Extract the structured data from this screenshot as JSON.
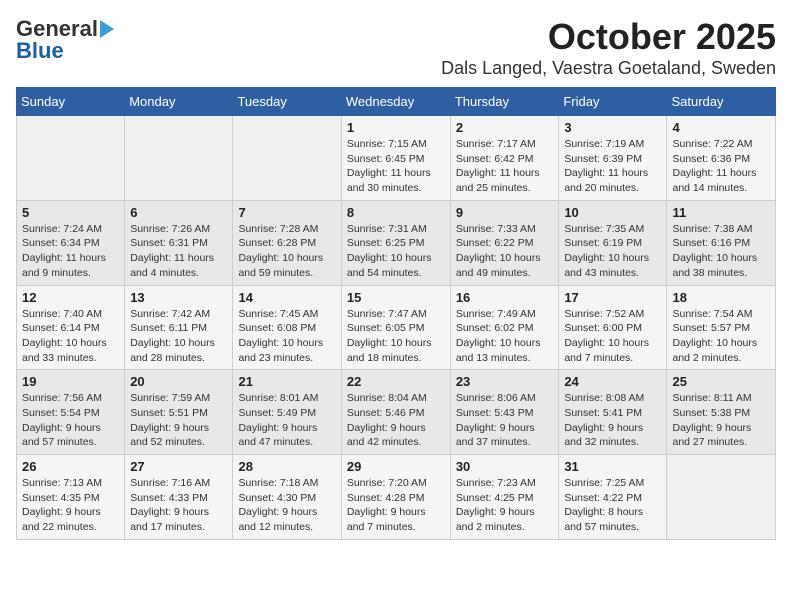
{
  "logo": {
    "text_general": "General",
    "text_blue": "Blue"
  },
  "title": "October 2025",
  "subtitle": "Dals Langed, Vaestra Goetaland, Sweden",
  "days_header": [
    "Sunday",
    "Monday",
    "Tuesday",
    "Wednesday",
    "Thursday",
    "Friday",
    "Saturday"
  ],
  "weeks": [
    [
      {
        "day": "",
        "detail": ""
      },
      {
        "day": "",
        "detail": ""
      },
      {
        "day": "",
        "detail": ""
      },
      {
        "day": "1",
        "detail": "Sunrise: 7:15 AM\nSunset: 6:45 PM\nDaylight: 11 hours\nand 30 minutes."
      },
      {
        "day": "2",
        "detail": "Sunrise: 7:17 AM\nSunset: 6:42 PM\nDaylight: 11 hours\nand 25 minutes."
      },
      {
        "day": "3",
        "detail": "Sunrise: 7:19 AM\nSunset: 6:39 PM\nDaylight: 11 hours\nand 20 minutes."
      },
      {
        "day": "4",
        "detail": "Sunrise: 7:22 AM\nSunset: 6:36 PM\nDaylight: 11 hours\nand 14 minutes."
      }
    ],
    [
      {
        "day": "5",
        "detail": "Sunrise: 7:24 AM\nSunset: 6:34 PM\nDaylight: 11 hours\nand 9 minutes."
      },
      {
        "day": "6",
        "detail": "Sunrise: 7:26 AM\nSunset: 6:31 PM\nDaylight: 11 hours\nand 4 minutes."
      },
      {
        "day": "7",
        "detail": "Sunrise: 7:28 AM\nSunset: 6:28 PM\nDaylight: 10 hours\nand 59 minutes."
      },
      {
        "day": "8",
        "detail": "Sunrise: 7:31 AM\nSunset: 6:25 PM\nDaylight: 10 hours\nand 54 minutes."
      },
      {
        "day": "9",
        "detail": "Sunrise: 7:33 AM\nSunset: 6:22 PM\nDaylight: 10 hours\nand 49 minutes."
      },
      {
        "day": "10",
        "detail": "Sunrise: 7:35 AM\nSunset: 6:19 PM\nDaylight: 10 hours\nand 43 minutes."
      },
      {
        "day": "11",
        "detail": "Sunrise: 7:38 AM\nSunset: 6:16 PM\nDaylight: 10 hours\nand 38 minutes."
      }
    ],
    [
      {
        "day": "12",
        "detail": "Sunrise: 7:40 AM\nSunset: 6:14 PM\nDaylight: 10 hours\nand 33 minutes."
      },
      {
        "day": "13",
        "detail": "Sunrise: 7:42 AM\nSunset: 6:11 PM\nDaylight: 10 hours\nand 28 minutes."
      },
      {
        "day": "14",
        "detail": "Sunrise: 7:45 AM\nSunset: 6:08 PM\nDaylight: 10 hours\nand 23 minutes."
      },
      {
        "day": "15",
        "detail": "Sunrise: 7:47 AM\nSunset: 6:05 PM\nDaylight: 10 hours\nand 18 minutes."
      },
      {
        "day": "16",
        "detail": "Sunrise: 7:49 AM\nSunset: 6:02 PM\nDaylight: 10 hours\nand 13 minutes."
      },
      {
        "day": "17",
        "detail": "Sunrise: 7:52 AM\nSunset: 6:00 PM\nDaylight: 10 hours\nand 7 minutes."
      },
      {
        "day": "18",
        "detail": "Sunrise: 7:54 AM\nSunset: 5:57 PM\nDaylight: 10 hours\nand 2 minutes."
      }
    ],
    [
      {
        "day": "19",
        "detail": "Sunrise: 7:56 AM\nSunset: 5:54 PM\nDaylight: 9 hours\nand 57 minutes."
      },
      {
        "day": "20",
        "detail": "Sunrise: 7:59 AM\nSunset: 5:51 PM\nDaylight: 9 hours\nand 52 minutes."
      },
      {
        "day": "21",
        "detail": "Sunrise: 8:01 AM\nSunset: 5:49 PM\nDaylight: 9 hours\nand 47 minutes."
      },
      {
        "day": "22",
        "detail": "Sunrise: 8:04 AM\nSunset: 5:46 PM\nDaylight: 9 hours\nand 42 minutes."
      },
      {
        "day": "23",
        "detail": "Sunrise: 8:06 AM\nSunset: 5:43 PM\nDaylight: 9 hours\nand 37 minutes."
      },
      {
        "day": "24",
        "detail": "Sunrise: 8:08 AM\nSunset: 5:41 PM\nDaylight: 9 hours\nand 32 minutes."
      },
      {
        "day": "25",
        "detail": "Sunrise: 8:11 AM\nSunset: 5:38 PM\nDaylight: 9 hours\nand 27 minutes."
      }
    ],
    [
      {
        "day": "26",
        "detail": "Sunrise: 7:13 AM\nSunset: 4:35 PM\nDaylight: 9 hours\nand 22 minutes."
      },
      {
        "day": "27",
        "detail": "Sunrise: 7:16 AM\nSunset: 4:33 PM\nDaylight: 9 hours\nand 17 minutes."
      },
      {
        "day": "28",
        "detail": "Sunrise: 7:18 AM\nSunset: 4:30 PM\nDaylight: 9 hours\nand 12 minutes."
      },
      {
        "day": "29",
        "detail": "Sunrise: 7:20 AM\nSunset: 4:28 PM\nDaylight: 9 hours\nand 7 minutes."
      },
      {
        "day": "30",
        "detail": "Sunrise: 7:23 AM\nSunset: 4:25 PM\nDaylight: 9 hours\nand 2 minutes."
      },
      {
        "day": "31",
        "detail": "Sunrise: 7:25 AM\nSunset: 4:22 PM\nDaylight: 8 hours\nand 57 minutes."
      },
      {
        "day": "",
        "detail": ""
      }
    ]
  ]
}
